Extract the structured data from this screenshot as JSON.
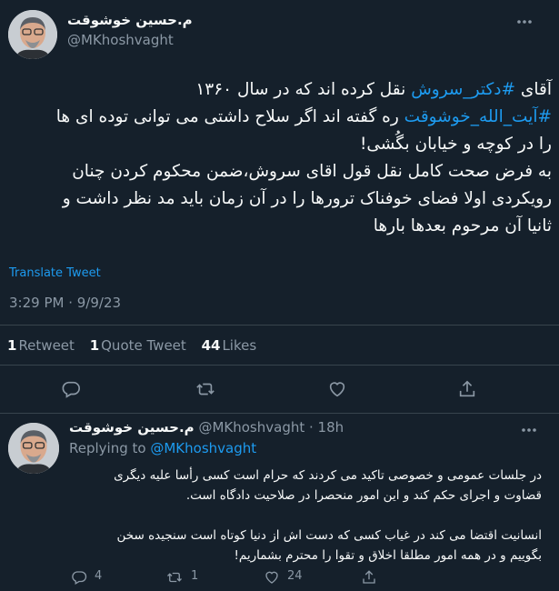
{
  "main_tweet": {
    "author_name": "م.حسین خوشوقت",
    "handle": "@MKhoshvaght",
    "text_lines": [
      {
        "parts": [
          {
            "t": "آقای ",
            "link": false
          },
          {
            "t": "#دکتر_سروش",
            "link": true
          },
          {
            "t": " نقل کرده اند که در سال ۱۳۶۰",
            "link": false
          }
        ]
      },
      {
        "parts": [
          {
            "t": "#آیت_الله_خوشوقت",
            "link": true
          },
          {
            "t": " ره گفته اند اگر سلاح داشتی می توانی توده ای ها",
            "link": false
          }
        ]
      },
      {
        "parts": [
          {
            "t": "را در کوچه و خیابان بگُشی!",
            "link": false
          }
        ]
      },
      {
        "parts": [
          {
            "t": "به فرض صحت کامل نقل قول اقای سروش،ضمن محکوم کردن چنان",
            "link": false
          }
        ]
      },
      {
        "parts": [
          {
            "t": "رویکردی اولا فضای خوفناک ترورها را در آن زمان باید مد نظر داشت و",
            "link": false
          }
        ]
      },
      {
        "parts": [
          {
            "t": "ثانیا آن مرحوم بعدها بارها",
            "link": false
          }
        ]
      }
    ],
    "translate_label": "Translate Tweet",
    "timestamp": "3:29 PM · 9/9/23",
    "stats": {
      "retweets_count": "1",
      "retweets_label": "Retweet",
      "quotes_count": "1",
      "quotes_label": "Quote Tweet",
      "likes_count": "44",
      "likes_label": "Likes"
    }
  },
  "reply_tweet": {
    "author_name": "م.حسین خوشوقت",
    "handle": "@MKhoshvaght",
    "time": "· 18h",
    "replying_label": "Replying to",
    "replying_to": "@MKhoshvaght",
    "text_lines": [
      "در جلسات عمومی و خصوصی تاکید می کردند که حرام است کسی رأسا علیه دیگری",
      "قضاوت و اجرای حکم کند و این امور منحصرا در صلاحیت دادگاه است.",
      "",
      "انسانیت اقتضا می کند در غیاب کسی که دست اش از دنیا کوتاه است سنجیده سخن",
      "بگوییم و در همه امور مطلقا اخلاق و تقوا را محترم بشماریم!"
    ],
    "reply_count": "4",
    "retweet_count": "1",
    "like_count": "24"
  },
  "icons": [
    "more-icon",
    "reply-icon",
    "retweet-icon",
    "like-icon",
    "share-icon"
  ],
  "colors": {
    "background": "#15202b",
    "text": "#f7f9f9",
    "muted": "#8b98a5",
    "link": "#1d9bf0",
    "divider": "#38444d"
  }
}
